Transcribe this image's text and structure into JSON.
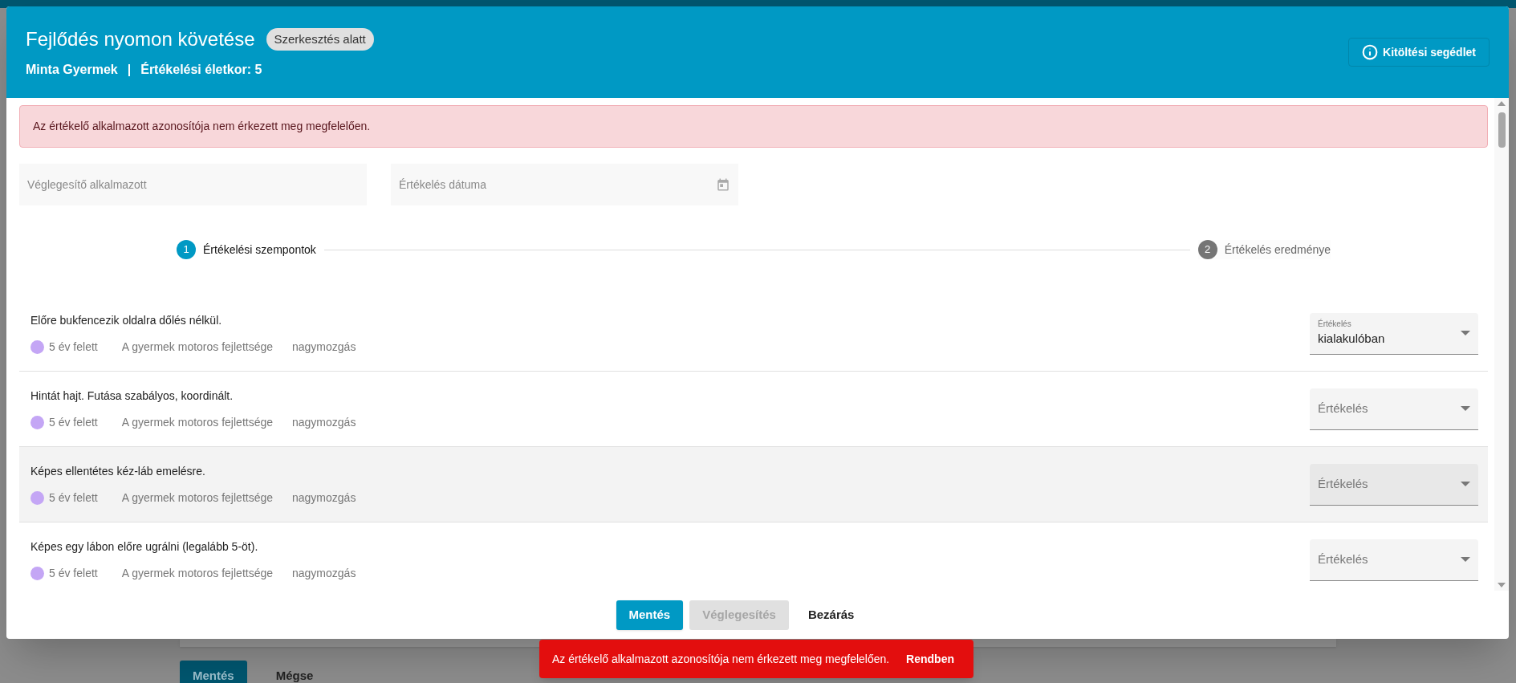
{
  "background_page": {
    "buttons": [
      {
        "label": "Mentés",
        "kind": "primary"
      },
      {
        "label": "Mégse",
        "kind": "text"
      }
    ]
  },
  "dialog": {
    "title": "Fejlődés nyomon követése",
    "status_badge": "Szerkesztés alatt",
    "subtitle_name": "Minta Gyermek",
    "subtitle_separator": "|",
    "subtitle_age": "Értékelési életkor: 5",
    "help_button": "Kitöltési segédlet",
    "alert": "Az értékelő alkalmazott azonosítója nem érkezett meg megfelelően.",
    "fields": [
      {
        "placeholder": "Véglegesítő alkalmazott",
        "kind": "text"
      },
      {
        "placeholder": "Értékelés dátuma",
        "kind": "date"
      }
    ],
    "steps": [
      {
        "number": "1",
        "label": "Értékelési szempontok",
        "selected": true
      },
      {
        "number": "2",
        "label": "Értékelés eredménye",
        "selected": false
      }
    ],
    "criteria": [
      {
        "text": "Előre bukfencezik oldalra dőlés nélkül.",
        "age": "5 év felett",
        "color": "#c4a6f5",
        "area": "A gyermek motoros fejlettsége",
        "subarea": "nagymozgás",
        "select_label": "Értékelés",
        "value": "kialakulóban",
        "highlighted": false
      },
      {
        "text": "Hintát hajt. Futása szabályos, koordinált.",
        "age": "5 év felett",
        "color": "#c4a6f5",
        "area": "A gyermek motoros fejlettsége",
        "subarea": "nagymozgás",
        "select_label": "Értékelés",
        "highlighted": false
      },
      {
        "text": "Képes ellentétes kéz-láb emelésre.",
        "age": "5 év felett",
        "color": "#c4a6f5",
        "area": "A gyermek motoros fejlettsége",
        "subarea": "nagymozgás",
        "select_label": "Értékelés",
        "highlighted": true
      },
      {
        "text": "Képes egy lábon előre ugrálni (legalább 5-öt).",
        "age": "5 év felett",
        "color": "#c4a6f5",
        "area": "A gyermek motoros fejlettsége",
        "subarea": "nagymozgás",
        "select_label": "Értékelés",
        "highlighted": false
      }
    ],
    "actions": [
      {
        "label": "Mentés",
        "kind": "primary",
        "disabled": false
      },
      {
        "label": "Véglegesítés",
        "kind": "primary",
        "disabled": true
      },
      {
        "label": "Bezárás",
        "kind": "text",
        "disabled": false
      }
    ]
  },
  "snackbar": {
    "message": "Az értékelő alkalmazott azonosítója nem érkezett meg megfelelően.",
    "action": "Rendben"
  }
}
